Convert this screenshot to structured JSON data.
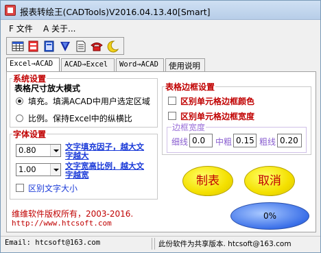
{
  "window": {
    "title": "报表转绘王(CADTools)V2016.04.13.40[Smart]"
  },
  "menu": {
    "items": [
      "F 文件",
      "A 关于..."
    ]
  },
  "toolbar": {
    "icons": [
      "table-icon",
      "red-document-icon",
      "blue-document-icon",
      "blue-arrow-down-icon",
      "page-icon",
      "phone-icon",
      "moon-icon"
    ]
  },
  "tabs": [
    {
      "label": "Excel→ACAD",
      "active": true
    },
    {
      "label": "ACAD→Excel",
      "active": false
    },
    {
      "label": "Word→ACAD",
      "active": false
    },
    {
      "label": "使用说明",
      "active": false
    }
  ],
  "system": {
    "group_label": "系统设置",
    "scale_heading": "表格尺寸放大模式",
    "options": [
      {
        "label": "填充。填满ACAD中用户选定区域",
        "selected": true
      },
      {
        "label": "比例。保持Excel中的纵横比",
        "selected": false
      }
    ]
  },
  "font": {
    "group_label": "字体设置",
    "fill_value": "0.80",
    "fill_desc": "文字填充因子，越大文字越大",
    "ratio_value": "1.00",
    "ratio_desc": "文字宽高比例，越大文字越宽",
    "distinguish_size_label": "区别文字大小"
  },
  "border": {
    "group_label": "表格边框设置",
    "color_label": "区别单元格边框颜色",
    "width_label": "区别单元格边框宽度",
    "width_group_label": "边框宽度",
    "thin_label": "细线",
    "thin_value": "0.0",
    "medium_label": "中粗",
    "medium_value": "0.15",
    "thick_label": "粗线",
    "thick_value": "0.20"
  },
  "actions": {
    "make_label": "制表",
    "cancel_label": "取消"
  },
  "footer": {
    "copyright": "维维软件版权所有，2003-2016.",
    "url": "http://www.htcsoft.com",
    "progress": "0%"
  },
  "status": {
    "email": "Email: htcsoft@163.com",
    "note": "此份软件为共享版本. htcsoft@163.com"
  },
  "colors": {
    "accent_red": "#c00000",
    "link_blue": "#1a3ad8",
    "button_yellow": "#f4e000",
    "progress_blue": "#3a6fe8"
  }
}
